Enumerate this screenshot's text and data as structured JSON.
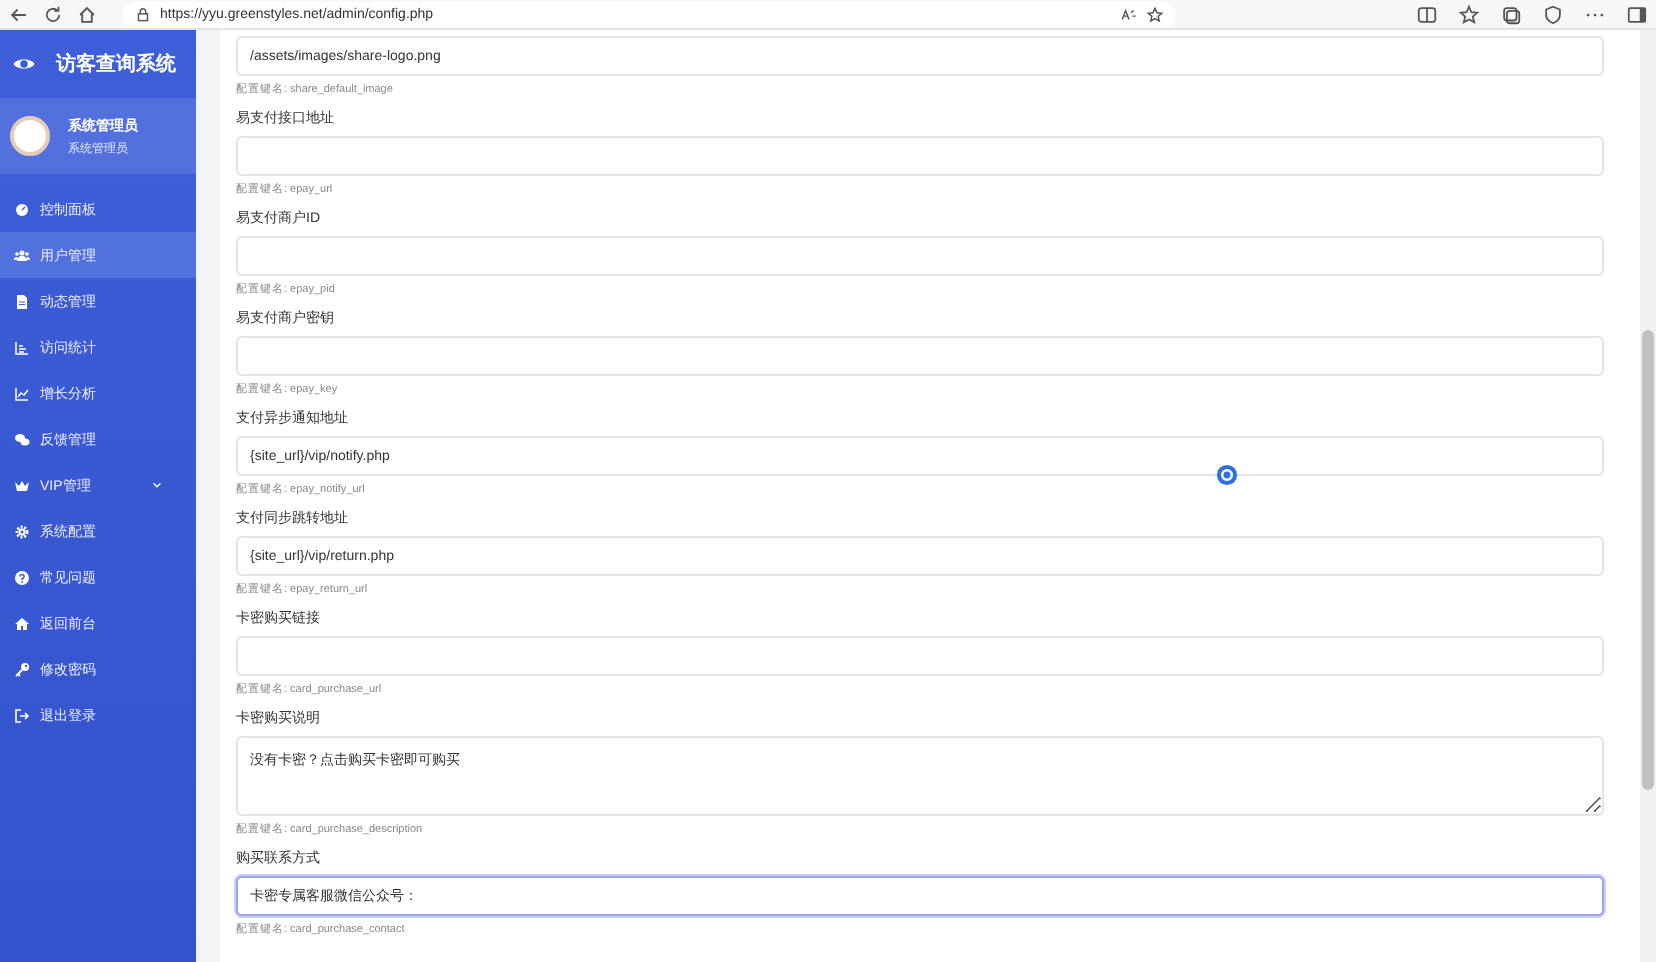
{
  "browser": {
    "url": "https://yyu.greenstyles.net/admin/config.php"
  },
  "sidebar": {
    "brand": "访客查询系统",
    "user": {
      "name": "系统管理员",
      "role": "系统管理员"
    },
    "items": [
      {
        "label": "控制面板",
        "selected": false
      },
      {
        "label": "用户管理",
        "selected": true
      },
      {
        "label": "动态管理",
        "selected": false
      },
      {
        "label": "访问统计",
        "selected": false
      },
      {
        "label": "增长分析",
        "selected": false
      },
      {
        "label": "反馈管理",
        "selected": false
      },
      {
        "label": "VIP管理",
        "selected": false,
        "expanded": false
      },
      {
        "label": "系统配置",
        "selected": false
      },
      {
        "label": "常见问题",
        "selected": false
      },
      {
        "label": "返回前台",
        "selected": false
      },
      {
        "label": "修改密码",
        "selected": false
      },
      {
        "label": "退出登录",
        "selected": false
      }
    ]
  },
  "fields": [
    {
      "kind": "input",
      "value": "/assets/images/share-logo.png",
      "hint": "配置键名: share_default_image",
      "focused": false
    },
    {
      "kind": "input",
      "label": "易支付接口地址",
      "hint": "配置键名: epay_url",
      "focused": false
    },
    {
      "kind": "input",
      "label": "易支付商户ID",
      "hint": "配置键名: epay_pid",
      "focused": false
    },
    {
      "kind": "input",
      "label": "易支付商户密钥",
      "hint": "配置键名: epay_key",
      "focused": false
    },
    {
      "kind": "input",
      "label": "支付异步通知地址",
      "value": "{site_url}/vip/notify.php",
      "hint": "配置键名: epay_notify_url",
      "focused": false
    },
    {
      "kind": "input",
      "label": "支付同步跳转地址",
      "value": "{site_url}/vip/return.php",
      "hint": "配置键名: epay_return_url",
      "focused": false
    },
    {
      "kind": "input",
      "label": "卡密购买链接",
      "hint": "配置键名: card_purchase_url",
      "focused": false
    },
    {
      "kind": "textarea",
      "label": "卡密购买说明",
      "value": "没有卡密？点击购买卡密即可购买",
      "hint": "配置键名: card_purchase_description",
      "focused": false
    },
    {
      "kind": "input",
      "label": "购买联系方式",
      "value": "卡密专属客服微信公众号：",
      "hint": "配置键名: card_purchase_contact",
      "focused": true
    }
  ]
}
